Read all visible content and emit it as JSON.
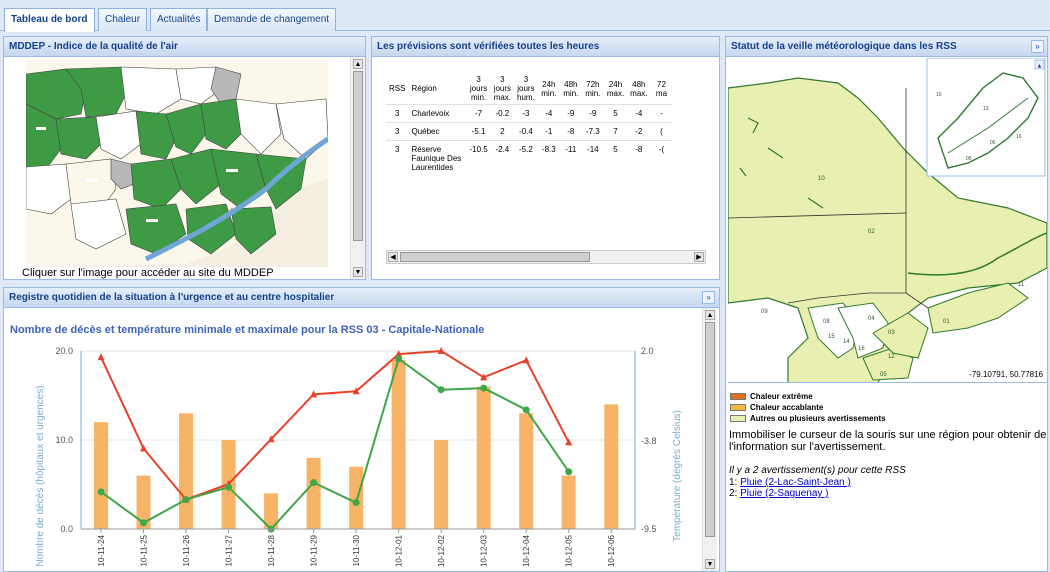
{
  "tabs": [
    {
      "label": "Tableau de bord",
      "active": true
    },
    {
      "label": "Chaleur",
      "active": false
    },
    {
      "label": "Actualités",
      "active": false
    },
    {
      "label": "Demande de changement",
      "active": false
    }
  ],
  "air_panel": {
    "title": "MDDEP - Indice de la qualité de l'air",
    "caption": "Cliquer sur l'image pour accéder au site du MDDEP"
  },
  "forecast_panel": {
    "title": "Les prévisions sont vérifiées toutes les heures",
    "headers": [
      "RSS",
      "Région",
      "3 jours min.",
      "3 jours max.",
      "3 jours hum.",
      "24h min.",
      "48h min.",
      "72h min.",
      "24h max.",
      "48h max.",
      "72 ma"
    ],
    "rows": [
      [
        "3",
        "Charlevoix",
        "-7",
        "-0.2",
        "-3",
        "-4",
        "-9",
        "-9",
        "5",
        "-4",
        "-"
      ],
      [
        "3",
        "Québec",
        "-5.1",
        "2",
        "-0.4",
        "-1",
        "-8",
        "-7.3",
        "7",
        "-2",
        "("
      ],
      [
        "3",
        "Réserve Faunique Des Laurentides",
        "-10.5",
        "-2.4",
        "-5.2",
        "-8.3",
        "-11",
        "-14",
        "5",
        "-8",
        "-("
      ]
    ]
  },
  "watch_panel": {
    "title": "Statut de la veille météorologique dans les RSS",
    "coords": "-79.10791, 50.77816",
    "region_labels": [
      "10",
      "02",
      "09",
      "08",
      "15",
      "14",
      "16",
      "04",
      "03",
      "12",
      "05",
      "11",
      "01"
    ],
    "inset_labels": [
      "15",
      "13",
      "06",
      "16",
      "05"
    ],
    "legend": [
      {
        "label": "Chaleur extrême",
        "color": "#e07020"
      },
      {
        "label": "Chaleur accablante",
        "color": "#f5b940"
      },
      {
        "label": "Autres ou plusieurs avertissements",
        "color": "#e8efb0"
      }
    ],
    "instructions": "Immobiliser le curseur de la souris sur une région pour obtenir de l'information sur l'avertissement.",
    "warnings_count": "Il y a 2 avertissement(s) pour cette RSS",
    "warnings": [
      {
        "num": "1:",
        "link": "Pluie (2-Lac-Saint-Jean )"
      },
      {
        "num": "2:",
        "link": "Pluie (2-Saguenay )"
      }
    ]
  },
  "registry_panel": {
    "title": "Registre quotidien de la situation à l'urgence et au centre hospitalier"
  },
  "chart_data": {
    "type": "bar+line",
    "title": "Nombre de décès et température minimale et maximale pour la RSS 03 - Capitale-Nationale",
    "ylabel": "Nombre de décès (hôpitaux et urgences)",
    "y2label": "Température (degrés Celsius)",
    "ylim": [
      0,
      20
    ],
    "y2lim": [
      -9.5,
      2.0
    ],
    "yticks": [
      "20.0",
      "10.0",
      "0.0"
    ],
    "y2ticks": [
      "2.0",
      "-3.8",
      "-9.5"
    ],
    "categories": [
      "10-11-24",
      "10-11-25",
      "10-11-26",
      "10-11-27",
      "10-11-28",
      "10-11-29",
      "10-11-30",
      "10-12-01",
      "10-12-02",
      "10-12-03",
      "10-12-04",
      "10-12-05",
      "10-12-06"
    ],
    "bars": {
      "color": "#f7b466",
      "values": [
        12,
        6,
        13,
        10,
        4,
        8,
        7,
        19,
        10,
        16,
        13,
        6,
        14
      ]
    },
    "series": [
      {
        "color": "#e8412a",
        "marker": "triangle",
        "values": [
          1.6,
          -4.3,
          -7.6,
          -6.6,
          -3.7,
          -0.8,
          -0.6,
          1.8,
          2.0,
          0.3,
          1.4,
          -3.9,
          null
        ]
      },
      {
        "color": "#3fa64a",
        "marker": "circle",
        "values": [
          -7.1,
          -9.1,
          -7.6,
          -6.8,
          -9.5,
          -6.5,
          -7.8,
          1.5,
          -0.5,
          -0.4,
          -1.8,
          -5.8,
          null
        ]
      }
    ]
  }
}
